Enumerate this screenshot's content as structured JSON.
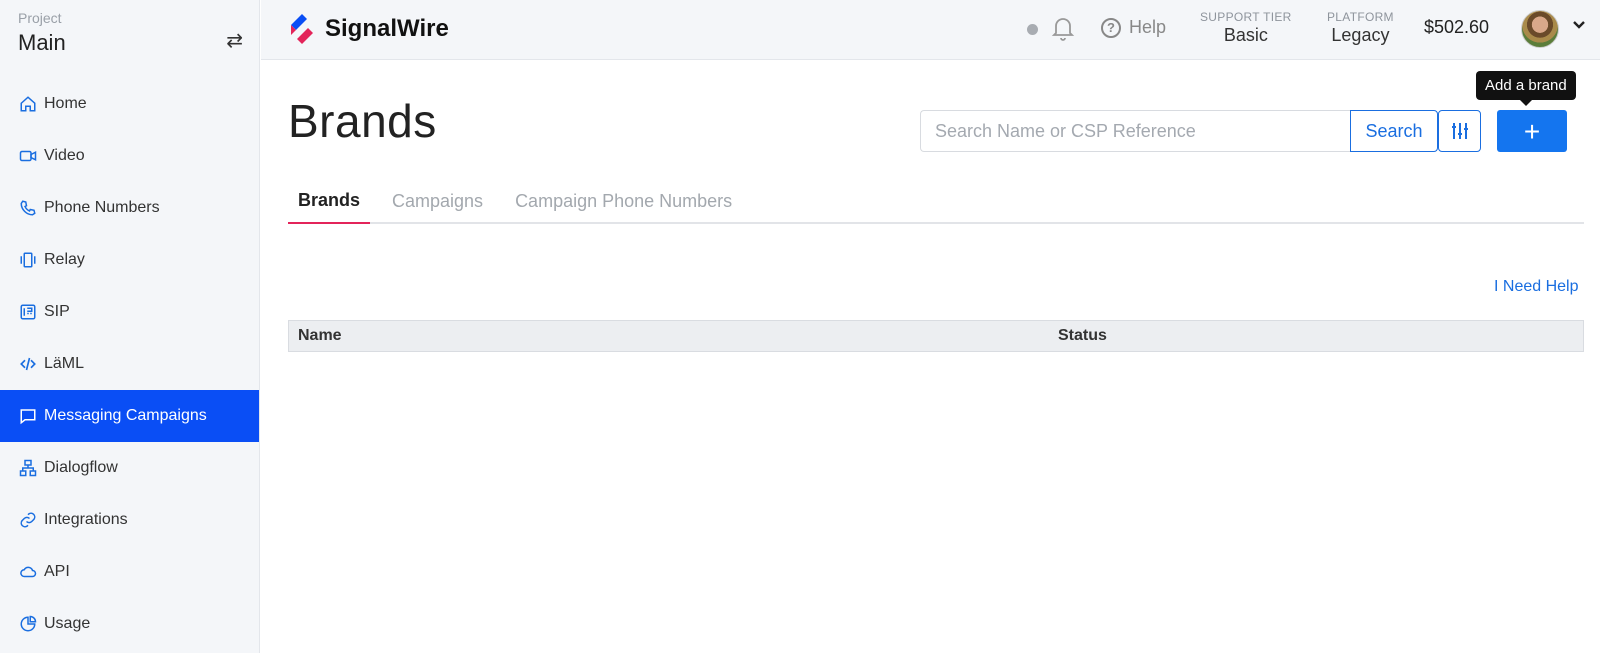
{
  "sidebar": {
    "project_label": "Project",
    "project_name": "Main",
    "items": [
      {
        "label": "Home",
        "icon": "home-icon"
      },
      {
        "label": "Video",
        "icon": "video-icon"
      },
      {
        "label": "Phone Numbers",
        "icon": "phone-icon"
      },
      {
        "label": "Relay",
        "icon": "relay-icon"
      },
      {
        "label": "SIP",
        "icon": "sip-icon"
      },
      {
        "label": "LäML",
        "icon": "code-icon"
      },
      {
        "label": "Messaging Campaigns",
        "icon": "message-icon",
        "active": true
      },
      {
        "label": "Dialogflow",
        "icon": "dialogflow-icon"
      },
      {
        "label": "Integrations",
        "icon": "link-icon"
      },
      {
        "label": "API",
        "icon": "cloud-icon"
      },
      {
        "label": "Usage",
        "icon": "pie-chart-icon"
      }
    ]
  },
  "topbar": {
    "brand": "SignalWire",
    "help_label": "Help",
    "support_tier_label": "SUPPORT TIER",
    "support_tier_value": "Basic",
    "platform_label": "PLATFORM",
    "platform_value": "Legacy",
    "balance": "$502.60"
  },
  "main": {
    "title": "Brands",
    "search_placeholder": "Search Name or CSP Reference",
    "search_button": "Search",
    "add_button": "+",
    "tooltip": "Add a brand",
    "tabs": [
      "Brands",
      "Campaigns",
      "Campaign Phone Numbers"
    ],
    "need_help": "I Need Help",
    "columns": [
      "Name",
      "Status"
    ]
  },
  "colors": {
    "accent": "#0a4ef5",
    "link": "#1a6ee0",
    "tab_underline": "#e3245a"
  }
}
